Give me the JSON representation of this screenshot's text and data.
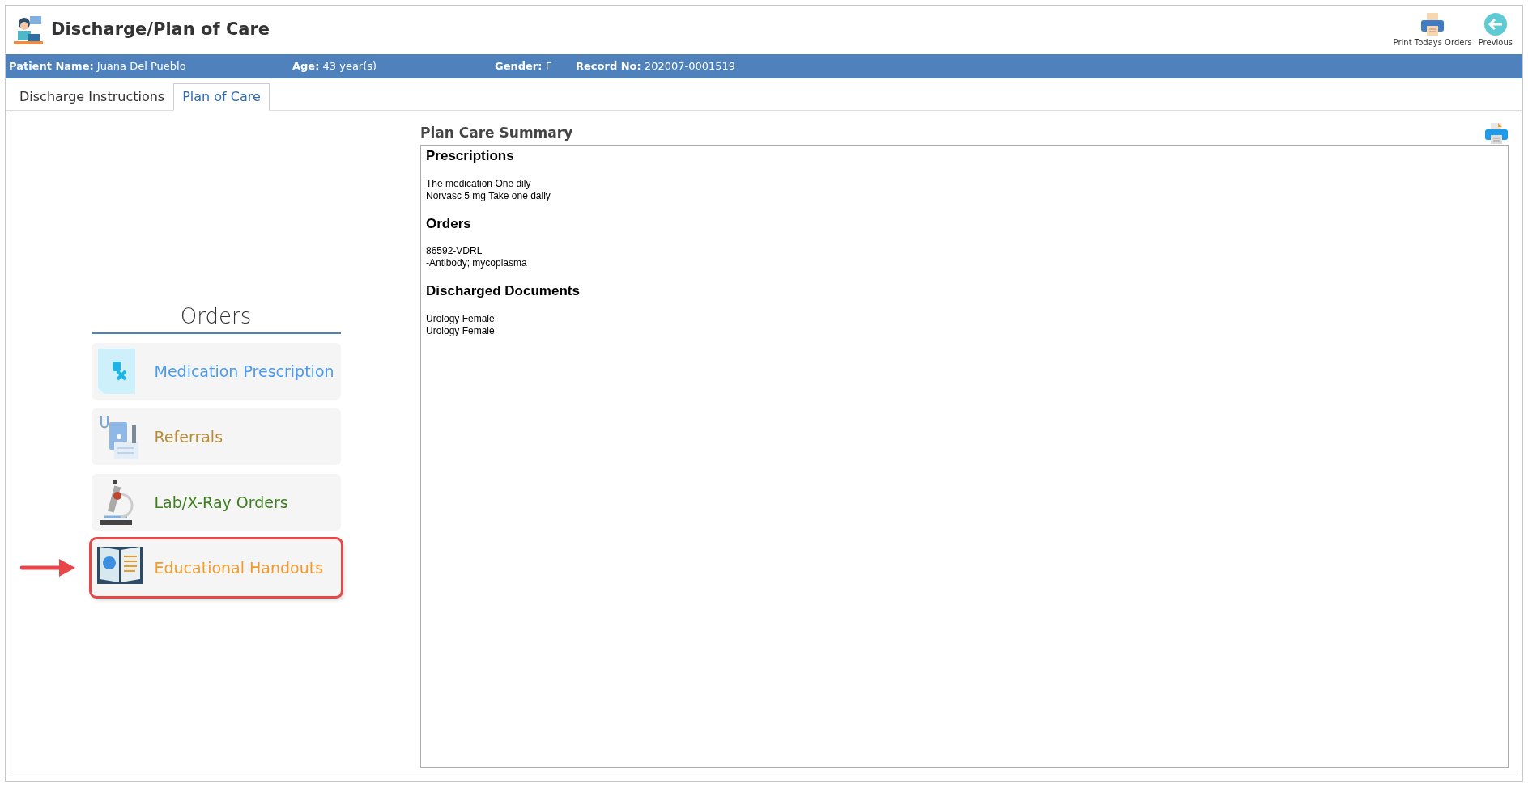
{
  "window": {
    "title": "Discharge/Plan of Care"
  },
  "toolbar": [
    {
      "kind": "print",
      "label": "Print Todays Orders"
    },
    {
      "kind": "back",
      "label": "Previous"
    }
  ],
  "patient_bar": [
    {
      "label": "Patient Name:",
      "value": "Juana Del Pueblo"
    },
    {
      "label": "Age:",
      "value": "43 year(s)"
    },
    {
      "label": "Gender:",
      "value": "F"
    },
    {
      "label": "Record No:",
      "value": "202007-0001519"
    }
  ],
  "tabs": [
    {
      "label": "Discharge Instructions",
      "selected": false
    },
    {
      "label": "Plan of Care",
      "selected": true
    }
  ],
  "orders": {
    "title": "Orders",
    "items": [
      {
        "kind": "prescription",
        "label": "Medication Prescription",
        "color": "#4a9bf0",
        "highlighted": false
      },
      {
        "kind": "referral",
        "label": "Referrals",
        "color": "#b98d35",
        "highlighted": false
      },
      {
        "kind": "lab",
        "label": "Lab/X-Ray Orders",
        "color": "#3d7f1f",
        "highlighted": false
      },
      {
        "kind": "education",
        "label": "Educational Handouts",
        "color": "#f39a2a",
        "highlighted": true
      }
    ]
  },
  "summary": {
    "title": "Plan Care Summary",
    "sections": [
      {
        "heading": "Prescriptions",
        "lines": [
          "The medication One dily",
          "Norvasc 5 mg Take one daily"
        ]
      },
      {
        "heading": "Orders",
        "lines": [
          "86592-VDRL",
          "-Antibody; mycoplasma"
        ]
      },
      {
        "heading": "Discharged Documents",
        "lines": [
          "Urology Female",
          "Urology Female"
        ]
      }
    ]
  }
}
